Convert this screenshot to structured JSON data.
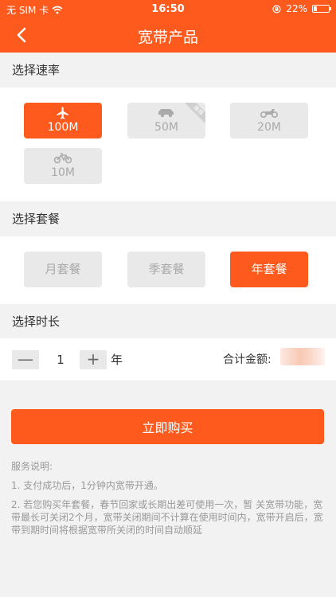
{
  "status_bar": {
    "carrier": "无 SIM 卡",
    "time": "16:50",
    "battery": "22%",
    "battery_level": 0.22
  },
  "header": {
    "title": "宽带产品"
  },
  "speed": {
    "section_label": "选择速率",
    "options": [
      {
        "label": "100M",
        "icon": "airplane-icon",
        "active": true
      },
      {
        "label": "50M",
        "icon": "car-icon",
        "active": false,
        "ribbon": "推荐"
      },
      {
        "label": "20M",
        "icon": "motorcycle-icon",
        "active": false
      },
      {
        "label": "10M",
        "icon": "bicycle-icon",
        "active": false
      }
    ]
  },
  "package": {
    "section_label": "选择套餐",
    "options": [
      {
        "label": "月套餐",
        "active": false
      },
      {
        "label": "季套餐",
        "active": false
      },
      {
        "label": "年套餐",
        "active": true
      }
    ]
  },
  "duration": {
    "section_label": "选择时长",
    "minus": "—",
    "plus": "+",
    "quantity": "1",
    "unit": "年",
    "total_label": "合计金额:"
  },
  "buy_button": "立即购买",
  "service_notes": {
    "title": "服务说明:",
    "items": [
      "1. 支付成功后，1分钟内宽带开通。",
      "2. 若您购买年套餐，春节回家或长期出差可使用一次，暂 关宽带功能，宽带最长可关闭2个月，宽带关闭期间不计算在使用时间内，宽带开启后，宽带到期时间将根据宽带所关闭的时间自动顺延"
    ]
  },
  "colors": {
    "accent": "#fe5a1e",
    "inactive_tile": "#e9e9e9",
    "page_bg": "#f2f2f2"
  }
}
